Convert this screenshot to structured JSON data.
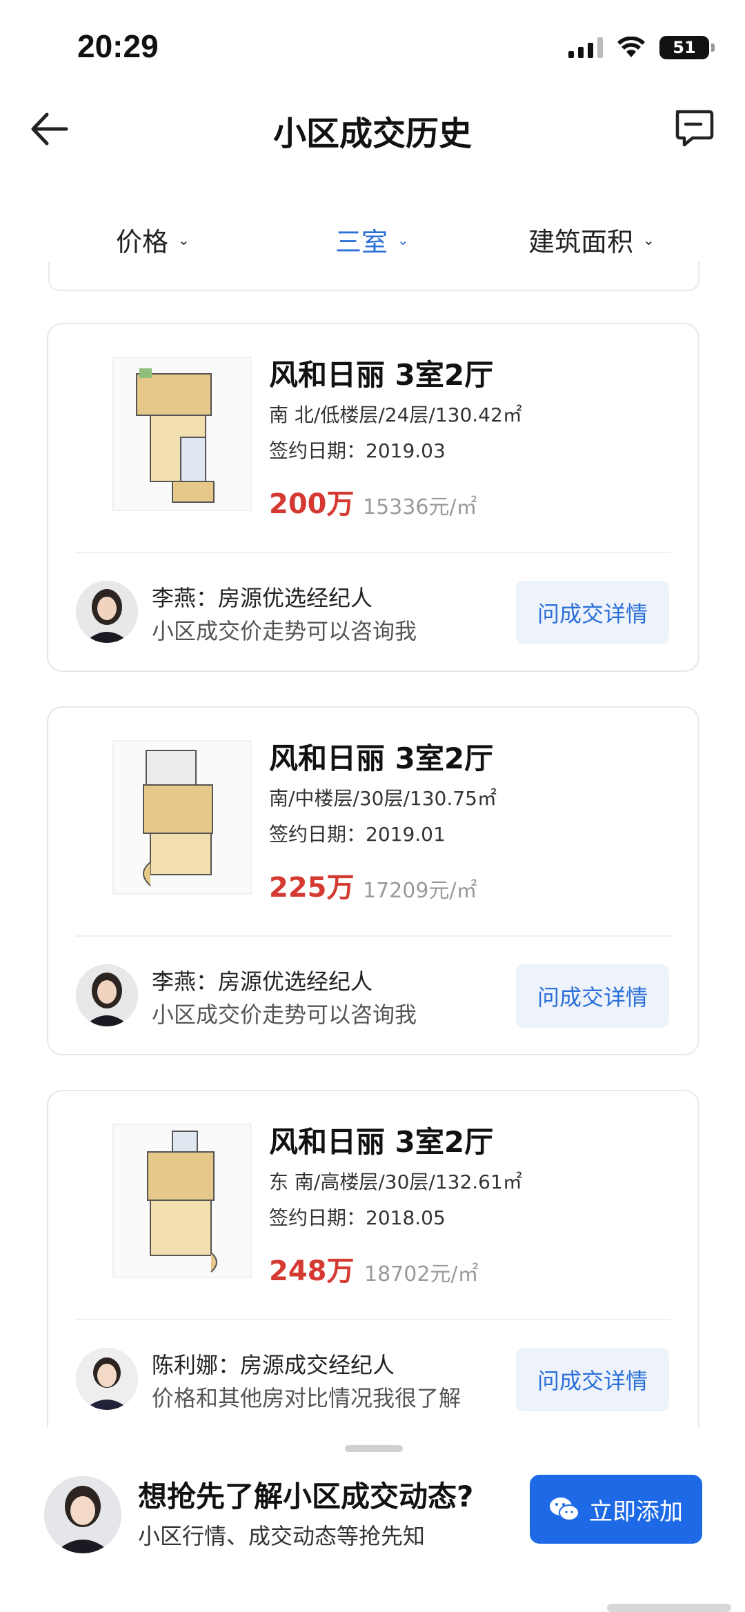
{
  "status_bar": {
    "time": "20:29",
    "battery": "51"
  },
  "nav": {
    "title": "小区成交历史"
  },
  "filters": [
    {
      "label": "价格"
    },
    {
      "label": "三室"
    },
    {
      "label": "建筑面积"
    }
  ],
  "listings": [
    {
      "title": "风和日丽 3室2厅",
      "meta": "南 北/低楼层/24层/130.42㎡",
      "date": "签约日期：2019.03",
      "price": "200万",
      "unit_price": "15336元/㎡",
      "agent_name": "李燕：房源优选经纪人",
      "agent_note": "小区成交价走势可以咨询我",
      "ask_label": "问成交详情"
    },
    {
      "title": "风和日丽 3室2厅",
      "meta": "南/中楼层/30层/130.75㎡",
      "date": "签约日期：2019.01",
      "price": "225万",
      "unit_price": "17209元/㎡",
      "agent_name": "李燕：房源优选经纪人",
      "agent_note": "小区成交价走势可以咨询我",
      "ask_label": "问成交详情"
    },
    {
      "title": "风和日丽 3室2厅",
      "meta": "东 南/高楼层/30层/132.61㎡",
      "date": "签约日期：2018.05",
      "price": "248万",
      "unit_price": "18702元/㎡",
      "agent_name": "陈利娜：房源成交经纪人",
      "agent_note": "价格和其他房对比情况我很了解",
      "ask_label": "问成交详情"
    }
  ],
  "promo": {
    "title": "想抢先了解小区成交动态?",
    "subtitle": "小区行情、成交动态等抢先知",
    "button_label": "立即添加"
  },
  "colors": {
    "accent": "#2b6fd8",
    "price": "#d43a32",
    "button": "#1e6ae6"
  }
}
